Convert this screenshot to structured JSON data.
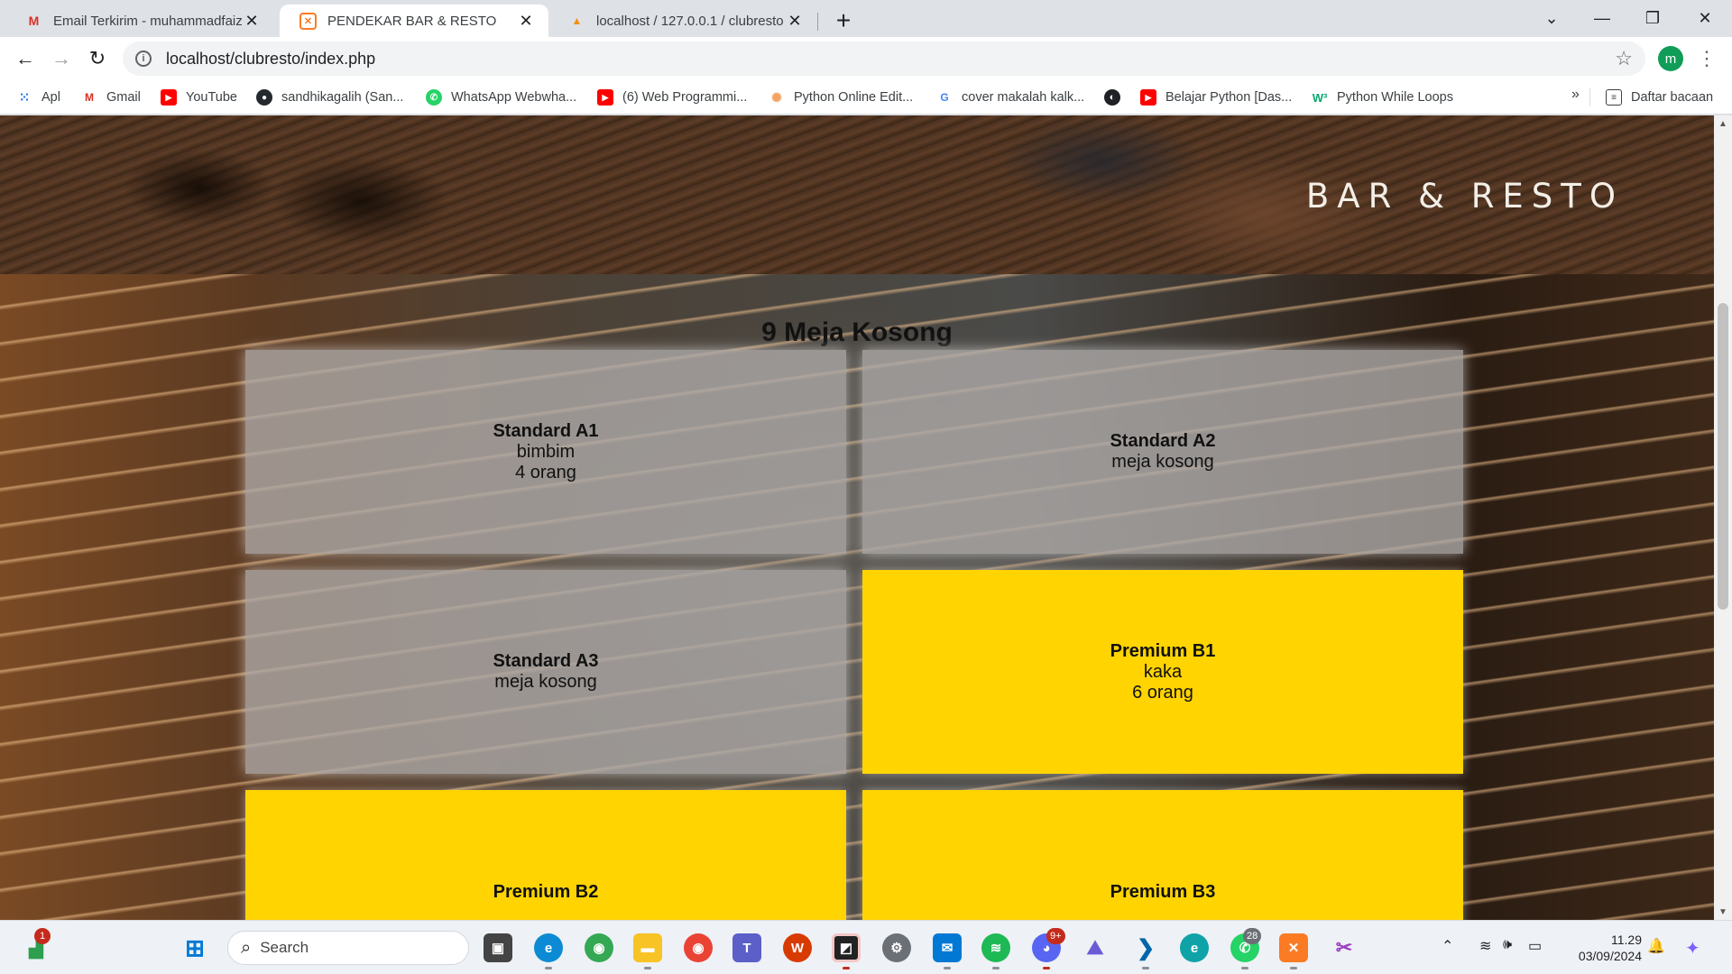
{
  "browser": {
    "tabs": [
      {
        "title": "Email Terkirim - muhammadfaiza",
        "icon": "gmail-icon",
        "active": false
      },
      {
        "title": "PENDEKAR BAR & RESTO",
        "icon": "xampp-icon",
        "active": true
      },
      {
        "title": "localhost / 127.0.0.1 / clubresto |",
        "icon": "phpmyadmin-icon",
        "active": false
      }
    ],
    "url": "localhost/clubresto/index.php",
    "profile_initial": "m",
    "bookmarks": [
      {
        "label": "Apl",
        "icon": "apps-grid-icon"
      },
      {
        "label": "Gmail",
        "icon": "gmail-icon"
      },
      {
        "label": "YouTube",
        "icon": "youtube-icon"
      },
      {
        "label": "sandhikagalih (San...",
        "icon": "github-icon"
      },
      {
        "label": "WhatsApp Webwha...",
        "icon": "whatsapp-icon"
      },
      {
        "label": "(6) Web Programmi...",
        "icon": "youtube-icon"
      },
      {
        "label": "Python Online Edit...",
        "icon": "python-editor-icon"
      },
      {
        "label": "cover makalah kalk...",
        "icon": "google-icon"
      },
      {
        "label": "",
        "icon": "globe-icon"
      },
      {
        "label": "Belajar Python [Das...",
        "icon": "youtube-icon"
      },
      {
        "label": "Python While Loops",
        "icon": "w3schools-icon"
      }
    ],
    "bookmarks_more": "»",
    "reading_list": "Daftar bacaan"
  },
  "page": {
    "brand": "BAR & RESTO",
    "heading": "9 Meja Kosong",
    "tables": [
      {
        "name": "Standard A1",
        "line1": "bimbim",
        "line2": "4 orang",
        "status": "terisi-abu"
      },
      {
        "name": "Standard A2",
        "line1": "meja kosong",
        "line2": "",
        "status": "kosong"
      },
      {
        "name": "Standard A3",
        "line1": "meja kosong",
        "line2": "",
        "status": "kosong"
      },
      {
        "name": "Premium B1",
        "line1": "kaka",
        "line2": "6 orang",
        "status": "terisi"
      },
      {
        "name": "Premium B2",
        "line1": "",
        "line2": "",
        "status": "terisi"
      },
      {
        "name": "Premium B3",
        "line1": "",
        "line2": "",
        "status": "terisi"
      }
    ],
    "colors": {
      "empty_card": "#afacaa",
      "filled_card": "#ffd400"
    }
  },
  "taskbar": {
    "search_label": "Search",
    "perf_badge": "1",
    "discord_badge": "9+",
    "whatsapp_badge": "28",
    "time": "11.29",
    "date": "03/09/2024"
  }
}
